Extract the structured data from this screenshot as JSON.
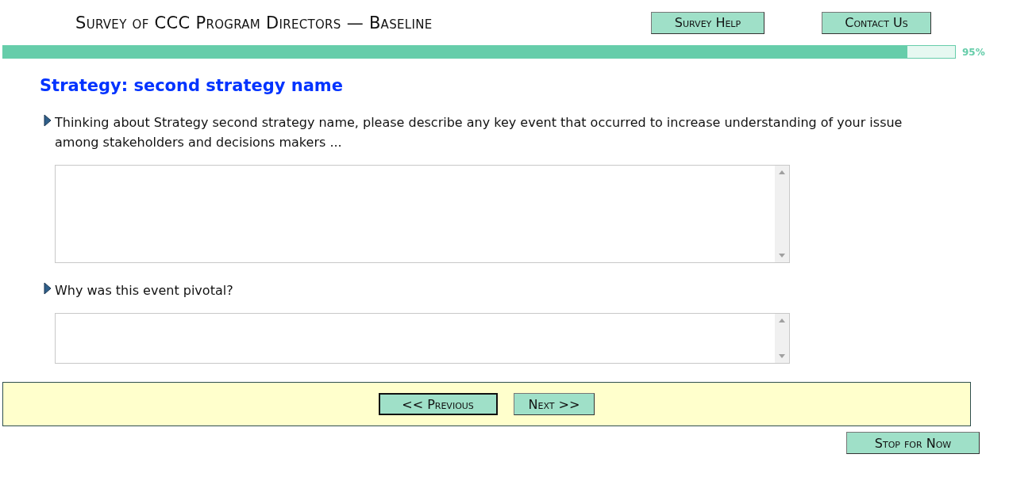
{
  "header": {
    "title": "Survey of CCC Program Directors — Baseline",
    "buttons": [
      {
        "label": "Survey Help"
      },
      {
        "label": "Contact Us"
      }
    ]
  },
  "progress": {
    "level": 0.95,
    "reading": "95%"
  },
  "section_title": "Strategy: second strategy name",
  "questions": [
    {
      "text": "Thinking about Strategy second strategy name, please describe any key event that occurred to increase understanding of your issue among stakeholders and decisions makers ...",
      "kind": "long"
    },
    {
      "text": "Why was this event pivotal?",
      "kind": "short"
    }
  ],
  "navigation": [
    {
      "label": "<< Previous",
      "focused": true
    },
    {
      "label": "Next >>",
      "focused": false
    }
  ],
  "stop_button": {
    "label": "Stop for Now"
  }
}
